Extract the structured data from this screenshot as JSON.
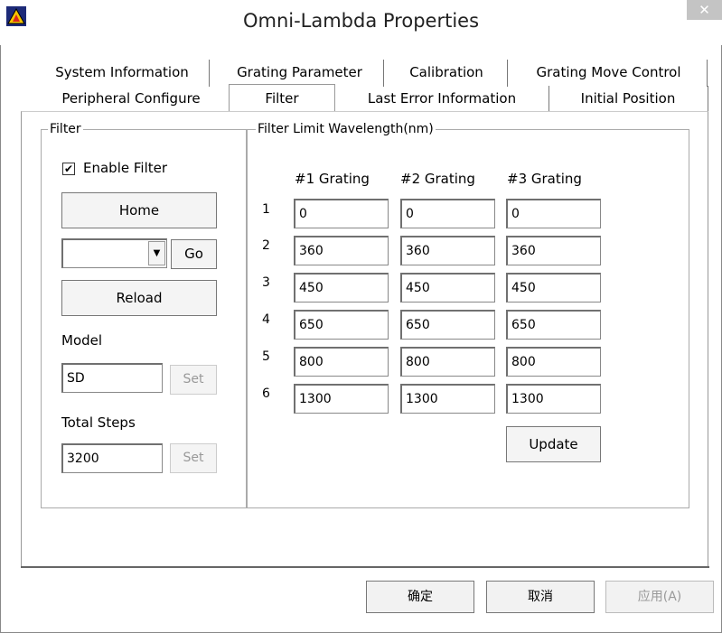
{
  "window": {
    "title": "Omni-Lambda Properties",
    "close_label": "✕"
  },
  "tabs_row1": [
    {
      "label": "System Information"
    },
    {
      "label": "Grating Parameter"
    },
    {
      "label": "Calibration"
    },
    {
      "label": "Grating Move Control"
    }
  ],
  "tabs_row2": [
    {
      "label": "Peripheral Configure"
    },
    {
      "label": "Filter",
      "active": true
    },
    {
      "label": "Last Error Information"
    },
    {
      "label": "Initial Position"
    }
  ],
  "filter_group": {
    "label": "Filter",
    "enable_label": "Enable Filter",
    "enable_checked": "✔",
    "home_label": "Home",
    "select_value": "",
    "go_label": "Go",
    "reload_label": "Reload",
    "model_label": "Model",
    "model_value": "SD",
    "model_set_label": "Set",
    "total_steps_label": "Total Steps",
    "total_steps_value": "3200",
    "steps_set_label": "Set"
  },
  "limit_group": {
    "label": "Filter Limit Wavelength(nm)",
    "columns": [
      "#1 Grating",
      "#2 Grating",
      "#3 Grating"
    ],
    "rows": [
      {
        "num": "1",
        "values": [
          "0",
          "0",
          "0"
        ]
      },
      {
        "num": "2",
        "values": [
          "360",
          "360",
          "360"
        ]
      },
      {
        "num": "3",
        "values": [
          "450",
          "450",
          "450"
        ]
      },
      {
        "num": "4",
        "values": [
          "650",
          "650",
          "650"
        ]
      },
      {
        "num": "5",
        "values": [
          "800",
          "800",
          "800"
        ]
      },
      {
        "num": "6",
        "values": [
          "1300",
          "1300",
          "1300"
        ]
      }
    ],
    "update_label": "Update"
  },
  "footer": {
    "ok_label": "确定",
    "cancel_label": "取消",
    "apply_label": "应用(A)"
  }
}
